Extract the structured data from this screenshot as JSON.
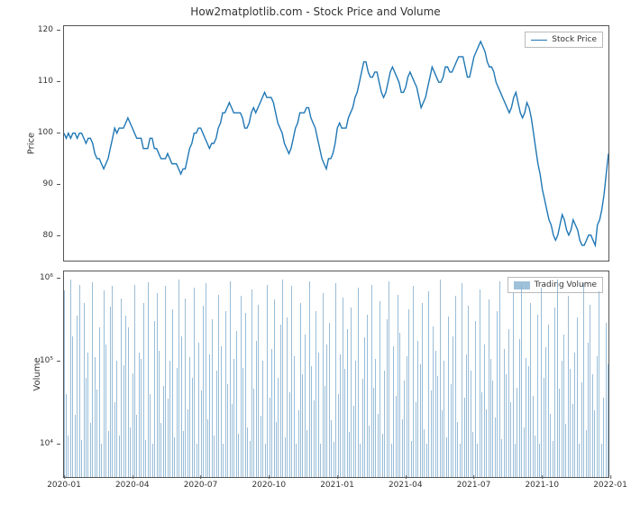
{
  "title": "How2matplotlib.com - Stock Price and Volume",
  "top": {
    "ylabel": "Price",
    "legend": "Stock Price",
    "yticks": [
      80,
      90,
      100,
      110,
      120
    ],
    "ymin": 75,
    "ymax": 121
  },
  "bot": {
    "ylabel": "Volume",
    "legend": "Trading Volume",
    "yticks_labels": [
      "10⁴",
      "10⁵",
      "10⁶"
    ],
    "yticks_exp": [
      4,
      5,
      6
    ],
    "ymin_exp": 3.6,
    "ymax_exp": 6.1
  },
  "xticks": [
    "2020-01",
    "2020-04",
    "2020-07",
    "2020-10",
    "2021-01",
    "2021-04",
    "2021-07",
    "2021-10",
    "2022-01"
  ],
  "chart_data": {
    "type": "line+bar",
    "title": "How2matplotlib.com - Stock Price and Volume",
    "x_start": "2020-01-01",
    "x_end": "2022-01-01",
    "n_days": 731,
    "series": [
      {
        "name": "Stock Price",
        "chart": "line",
        "ylabel": "Price",
        "ylim": [
          75,
          121
        ],
        "sample_every": 3,
        "values": [
          100,
          99,
          100,
          99,
          100,
          100,
          99,
          100,
          100,
          99,
          98,
          99,
          99,
          98,
          96,
          95,
          95,
          94,
          93,
          94,
          95,
          97,
          99,
          101,
          100,
          101,
          101,
          101,
          102,
          103,
          102,
          101,
          100,
          99,
          99,
          99,
          97,
          97,
          97,
          99,
          99,
          97,
          97,
          96,
          95,
          95,
          95,
          96,
          95,
          94,
          94,
          94,
          93,
          92,
          93,
          93,
          95,
          97,
          98,
          100,
          100,
          101,
          101,
          100,
          99,
          98,
          97,
          98,
          98,
          99,
          101,
          102,
          104,
          104,
          105,
          106,
          105,
          104,
          104,
          104,
          104,
          103,
          101,
          101,
          102,
          104,
          105,
          104,
          105,
          106,
          107,
          108,
          107,
          107,
          107,
          106,
          104,
          102,
          101,
          100,
          98,
          97,
          96,
          97,
          99,
          101,
          102,
          104,
          104,
          104,
          105,
          105,
          103,
          102,
          101,
          99,
          97,
          95,
          94,
          93,
          95,
          95,
          96,
          98,
          101,
          102,
          101,
          101,
          101,
          103,
          104,
          105,
          107,
          108,
          110,
          112,
          114,
          114,
          112,
          111,
          111,
          112,
          112,
          110,
          108,
          107,
          108,
          110,
          112,
          113,
          112,
          111,
          110,
          108,
          108,
          109,
          111,
          112,
          111,
          110,
          109,
          107,
          105,
          106,
          107,
          109,
          111,
          113,
          112,
          111,
          110,
          110,
          111,
          113,
          113,
          112,
          112,
          113,
          114,
          115,
          115,
          115,
          113,
          111,
          111,
          113,
          115,
          116,
          117,
          118,
          117,
          116,
          114,
          113,
          113,
          112,
          110,
          109,
          108,
          107,
          106,
          105,
          104,
          105,
          107,
          108,
          106,
          104,
          103,
          104,
          106,
          105,
          103,
          100,
          97,
          94,
          92,
          89,
          87,
          85,
          83,
          82,
          80,
          79,
          80,
          82,
          84,
          83,
          81,
          80,
          81,
          83,
          82,
          81,
          79,
          78,
          78,
          79,
          80,
          80,
          79,
          78,
          82,
          83,
          85,
          88,
          92,
          96
        ]
      },
      {
        "name": "Trading Volume",
        "chart": "bar",
        "ylabel": "Volume",
        "log": true,
        "ylim_exp": [
          3.6,
          6.1
        ],
        "sample_every": 3,
        "values_exp": [
          5.85,
          4.6,
          4.1,
          5.98,
          5.3,
          4.35,
          5.55,
          5.92,
          4.05,
          5.7,
          4.8,
          5.1,
          4.25,
          5.95,
          5.05,
          4.65,
          5.4,
          4.0,
          5.85,
          5.2,
          4.15,
          5.65,
          5.9,
          4.5,
          5.0,
          4.1,
          5.75,
          4.95,
          5.55,
          5.4,
          4.2,
          4.85,
          5.92,
          4.35,
          5.1,
          5.02,
          5.7,
          4.05,
          5.95,
          4.6,
          4.0,
          5.48,
          5.82,
          5.12,
          4.25,
          4.7,
          5.9,
          4.55,
          5.0,
          5.62,
          4.08,
          4.92,
          5.98,
          5.3,
          4.15,
          5.75,
          4.42,
          5.05,
          4.8,
          5.88,
          4.0,
          5.22,
          4.64,
          5.66,
          5.94,
          4.3,
          5.08,
          5.5,
          4.1,
          4.88,
          5.8,
          5.18,
          4.0,
          5.6,
          4.72,
          5.96,
          4.48,
          5.02,
          5.36,
          4.12,
          5.78,
          4.92,
          5.58,
          4.2,
          4.04,
          5.86,
          4.66,
          5.24,
          5.68,
          4.34,
          5.0,
          4.0,
          5.92,
          4.56,
          5.14,
          5.74,
          4.26,
          4.8,
          5.44,
          5.98,
          4.08,
          5.52,
          4.62,
          5.9,
          5.06,
          4.0,
          4.4,
          5.7,
          4.84,
          5.32,
          4.16,
          5.96,
          4.94,
          4.52,
          5.6,
          5.1,
          4.0,
          5.82,
          4.7,
          5.2,
          5.46,
          4.28,
          4.02,
          5.94,
          4.6,
          5.08,
          5.76,
          4.9,
          5.38,
          4.14,
          5.64,
          4.46,
          5.0,
          5.88,
          4.0,
          4.78,
          5.28,
          5.56,
          4.22,
          5.92,
          4.68,
          5.02,
          4.36,
          5.72,
          4.12,
          4.88,
          5.5,
          5.96,
          4.0,
          5.18,
          4.58,
          5.8,
          5.34,
          4.3,
          4.76,
          5.06,
          5.62,
          4.04,
          5.9,
          4.5,
          5.24,
          4.96,
          5.7,
          4.18,
          4.0,
          5.84,
          4.64,
          5.42,
          5.12,
          4.82,
          5.98,
          4.4,
          5.0,
          4.08,
          5.54,
          4.72,
          5.3,
          5.78,
          4.26,
          4.0,
          5.94,
          4.56,
          5.08,
          5.66,
          4.88,
          4.14,
          5.48,
          4.0,
          5.86,
          4.62,
          5.2,
          4.42,
          5.74,
          5.02,
          4.76,
          4.32,
          5.6,
          5.96,
          4.06,
          5.14,
          4.84,
          5.38,
          4.5,
          5.82,
          4.0,
          4.68,
          5.26,
          5.92,
          4.2,
          5.04,
          4.94,
          5.7,
          4.58,
          4.1,
          5.56,
          4.0,
          5.88,
          4.8,
          5.16,
          5.44,
          4.36,
          4.04,
          5.64,
          5.98,
          4.66,
          5.0,
          5.32,
          4.24,
          5.78,
          4.9,
          4.48,
          5.1,
          5.52,
          4.0,
          4.74,
          5.94,
          4.16,
          5.22,
          5.68,
          4.84,
          4.4,
          5.06,
          5.84,
          4.0,
          4.56,
          5.46,
          4.96,
          5.72
        ]
      }
    ],
    "xticks": [
      "2020-01",
      "2020-04",
      "2020-07",
      "2020-10",
      "2021-01",
      "2021-04",
      "2021-07",
      "2021-10",
      "2022-01"
    ]
  }
}
